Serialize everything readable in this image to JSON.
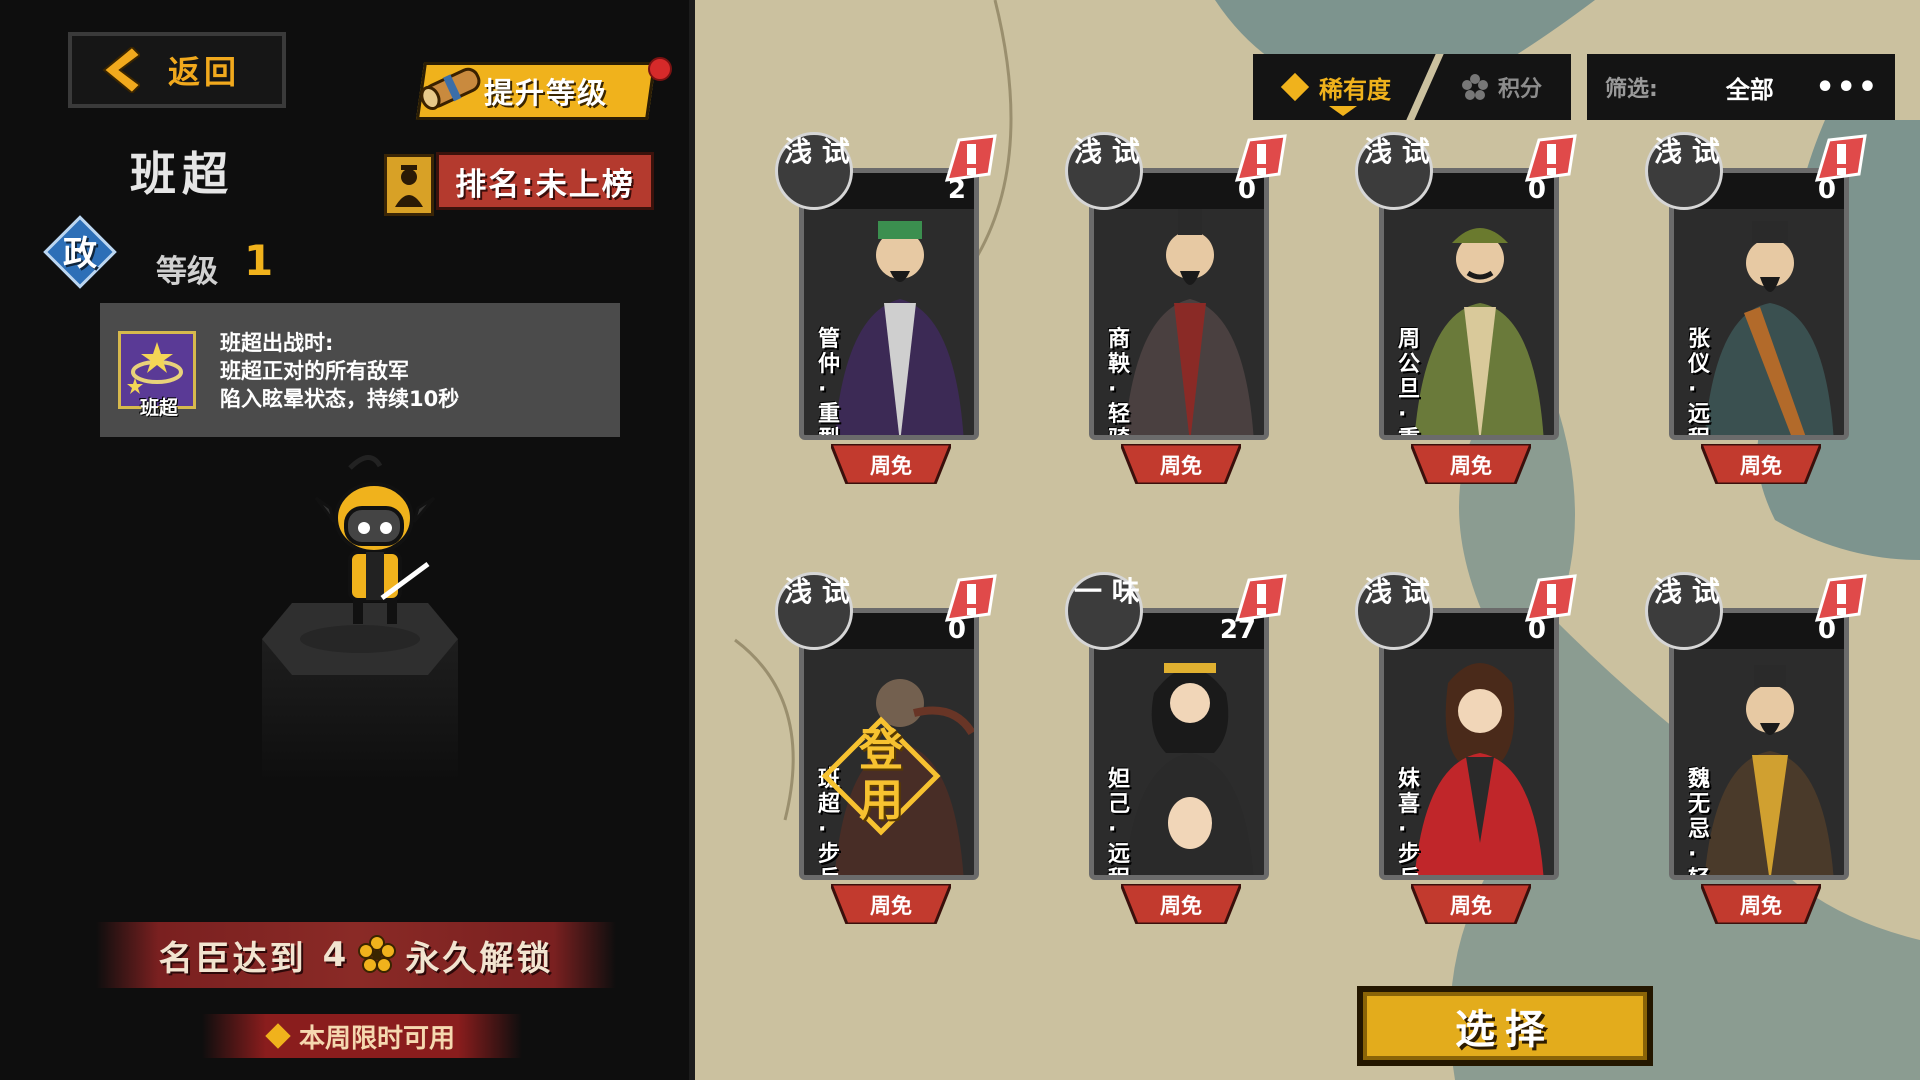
{
  "left_panel": {
    "back_label": "返回",
    "upgrade_label": "提升等级",
    "hero_name": "班超",
    "rank_label": "排名:未上榜",
    "class_badge": "政",
    "level_label": "等级",
    "level_value": "1",
    "skill": {
      "icon_caption": "班超",
      "lines": [
        "班超出战时:",
        "班超正对的所有敌军",
        "陷入眩晕状态，持续10秒"
      ]
    },
    "unlock": {
      "prefix": "名臣达到",
      "count": "4",
      "suffix": "永久解锁"
    },
    "limited_label": "本周限时可用"
  },
  "right_panel": {
    "tabs": {
      "rarity": "稀有度",
      "score": "积分"
    },
    "filter": {
      "label": "筛选:",
      "value": "全部",
      "more": "•••"
    },
    "cards": [
      {
        "seal": "浅 试",
        "count": "2",
        "name": "管仲·重型",
        "free": "周免"
      },
      {
        "seal": "浅 试",
        "count": "0",
        "name": "商鞅·轻骑",
        "free": "周免"
      },
      {
        "seal": "浅 试",
        "count": "0",
        "name": "周公旦·重型",
        "free": "周免"
      },
      {
        "seal": "浅 试",
        "count": "0",
        "name": "张仪·远程",
        "free": "周免"
      },
      {
        "seal": "浅 试",
        "count": "0",
        "name": "班超·步兵",
        "free": "周免",
        "badge": "登用"
      },
      {
        "seal": "一 味",
        "count": "27",
        "name": "妲己·远程",
        "free": "周免"
      },
      {
        "seal": "浅 试",
        "count": "0",
        "name": "妺喜·步兵",
        "free": "周免"
      },
      {
        "seal": "浅 试",
        "count": "0",
        "name": "魏无忌·轻骑",
        "free": "周免"
      }
    ],
    "select_label": "选择"
  },
  "colors": {
    "accent": "#f0b21c",
    "red": "#b43a2e",
    "map": "#cbc19f"
  },
  "icons": [
    "chevron-left-icon",
    "scroll-icon",
    "rank-portrait-icon",
    "skill-stun-icon",
    "flower-icon",
    "alert-icon"
  ]
}
